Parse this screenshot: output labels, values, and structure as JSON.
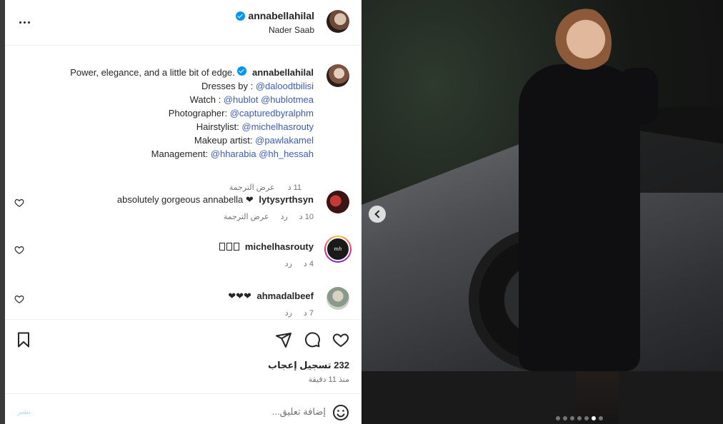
{
  "post": {
    "username": "annabellahilal",
    "location": "Nader Saab",
    "verified": true
  },
  "caption": {
    "username": "annabellahilal",
    "lines": [
      "Power, elegance, and a little bit of edge.",
      "Dresses by :",
      "Watch :",
      "Photographer:",
      "Hairstylist:",
      "Makeup artist:",
      "Management:"
    ],
    "mentions": {
      "dresses": "@daloodtbilisi",
      "watch_1": "@hublot",
      "watch_2": "@hublotmea",
      "photographer": "@capturedbyralphm",
      "hairstylist": "@michelhasrouty",
      "makeup": "@pawlakamel",
      "management_1": "@hharabia",
      "management_2": "@hh_hessah"
    },
    "time": "11 د",
    "translate": "عرض الترجمة"
  },
  "comments": [
    {
      "username": "lytysyrthsyn",
      "text": "absolutely gorgeous annabella ❤",
      "time": "10 د",
      "reply": "رد",
      "translate": "عرض الترجمة"
    },
    {
      "username": "michelhasrouty",
      "text": "",
      "time": "4 د",
      "reply": "رد",
      "avatar_text": "mh"
    },
    {
      "username": "ahmadalbeef",
      "text": "❤❤❤",
      "time": "7 د",
      "reply": "رد"
    }
  ],
  "actions": {
    "likes": "232 تسجيل إعجاب",
    "time_ago": "منذ 11 دقيقة"
  },
  "add_comment": {
    "placeholder": "إضافة تعليق...",
    "post_label": "نشر"
  },
  "carousel": {
    "total": 7,
    "active_index": 5
  },
  "colors": {
    "accent": "#0095f6",
    "mention": "#3b5bbf",
    "secondary_text": "#737373"
  }
}
